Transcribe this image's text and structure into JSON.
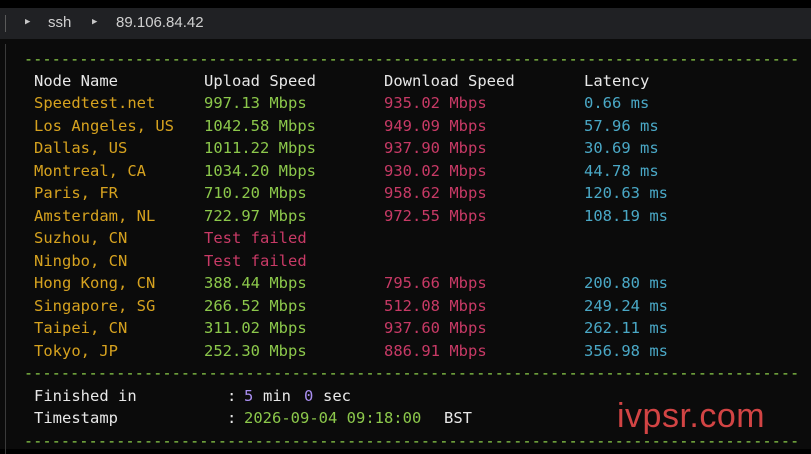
{
  "breadcrumb": {
    "item1": "ssh",
    "item2": "89.106.84.42"
  },
  "separator": "------------------------------------------------------------------------------------",
  "table": {
    "headers": [
      "Node Name",
      "Upload Speed",
      "Download Speed",
      "Latency"
    ],
    "rows": [
      {
        "node": "Speedtest.net",
        "upload": "997.13 Mbps",
        "download": "935.02 Mbps",
        "latency": "0.66 ms"
      },
      {
        "node": "Los Angeles, US",
        "upload": "1042.58 Mbps",
        "download": "949.09 Mbps",
        "latency": "57.96 ms"
      },
      {
        "node": "Dallas, US",
        "upload": "1011.22 Mbps",
        "download": "937.90 Mbps",
        "latency": "30.69 ms"
      },
      {
        "node": "Montreal, CA",
        "upload": "1034.20 Mbps",
        "download": "930.02 Mbps",
        "latency": "44.78 ms"
      },
      {
        "node": "Paris, FR",
        "upload": "710.20 Mbps",
        "download": "958.62 Mbps",
        "latency": "120.63 ms"
      },
      {
        "node": "Amsterdam, NL",
        "upload": "722.97 Mbps",
        "download": "972.55 Mbps",
        "latency": "108.19 ms"
      },
      {
        "node": "Suzhou, CN",
        "upload": "Test failed",
        "download": "",
        "latency": ""
      },
      {
        "node": "Ningbo, CN",
        "upload": "Test failed",
        "download": "",
        "latency": ""
      },
      {
        "node": "Hong Kong, CN",
        "upload": "388.44 Mbps",
        "download": "795.66 Mbps",
        "latency": "200.80 ms"
      },
      {
        "node": "Singapore, SG",
        "upload": "266.52 Mbps",
        "download": "512.08 Mbps",
        "latency": "249.24 ms"
      },
      {
        "node": "Taipei, CN",
        "upload": "311.02 Mbps",
        "download": "937.60 Mbps",
        "latency": "262.11 ms"
      },
      {
        "node": "Tokyo, JP",
        "upload": "252.30 Mbps",
        "download": "886.91 Mbps",
        "latency": "356.98 ms"
      }
    ]
  },
  "summary": {
    "finished_label": "Finished in",
    "colon": ":",
    "minutes": "5",
    "min_unit": "min",
    "seconds": "0",
    "sec_unit": "sec",
    "timestamp_label": "Timestamp",
    "timestamp_value": "2026-09-04 09:18:00",
    "timezone": "BST"
  },
  "watermark": "ivpsr.com"
}
